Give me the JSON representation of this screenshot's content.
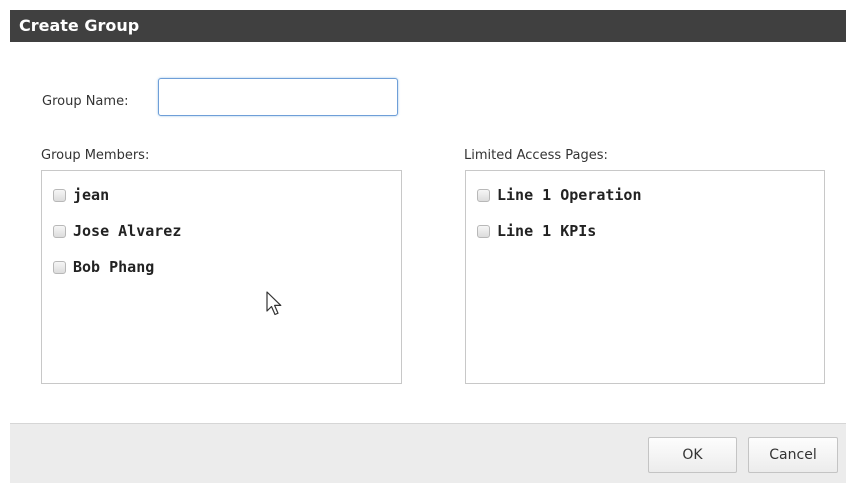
{
  "dialog": {
    "title": "Create Group",
    "group_name": {
      "label": "Group Name:",
      "value": "",
      "placeholder": ""
    },
    "members": {
      "label": "Group Members:",
      "items": [
        {
          "label": "jean",
          "checked": false
        },
        {
          "label": "Jose Alvarez",
          "checked": false
        },
        {
          "label": "Bob Phang",
          "checked": false
        }
      ]
    },
    "pages": {
      "label": "Limited Access Pages:",
      "items": [
        {
          "label": "Line 1 Operation",
          "checked": false
        },
        {
          "label": "Line 1 KPIs",
          "checked": false
        }
      ]
    },
    "buttons": {
      "ok_label": "OK",
      "cancel_label": "Cancel"
    }
  },
  "colors": {
    "title_bar": "#404040",
    "footer": "#ececec",
    "input_focus_border": "#6f9fd8"
  },
  "icons": {
    "cursor": "mouse-pointer-icon"
  }
}
